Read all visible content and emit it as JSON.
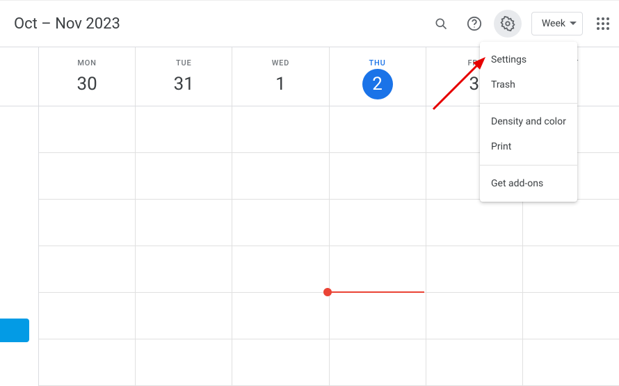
{
  "header": {
    "date_range": "Oct – Nov 2023",
    "view_label": "Week"
  },
  "days": [
    {
      "dow": "MON",
      "num": "30",
      "today": false
    },
    {
      "dow": "TUE",
      "num": "31",
      "today": false
    },
    {
      "dow": "WED",
      "num": "1",
      "today": false
    },
    {
      "dow": "THU",
      "num": "2",
      "today": true
    },
    {
      "dow": "FRI",
      "num": "3",
      "today": false
    },
    {
      "dow": "SAT",
      "num": "",
      "today": false
    }
  ],
  "settings_menu": {
    "settings": "Settings",
    "trash": "Trash",
    "density": "Density and color",
    "print": "Print",
    "addons": "Get add-ons"
  }
}
